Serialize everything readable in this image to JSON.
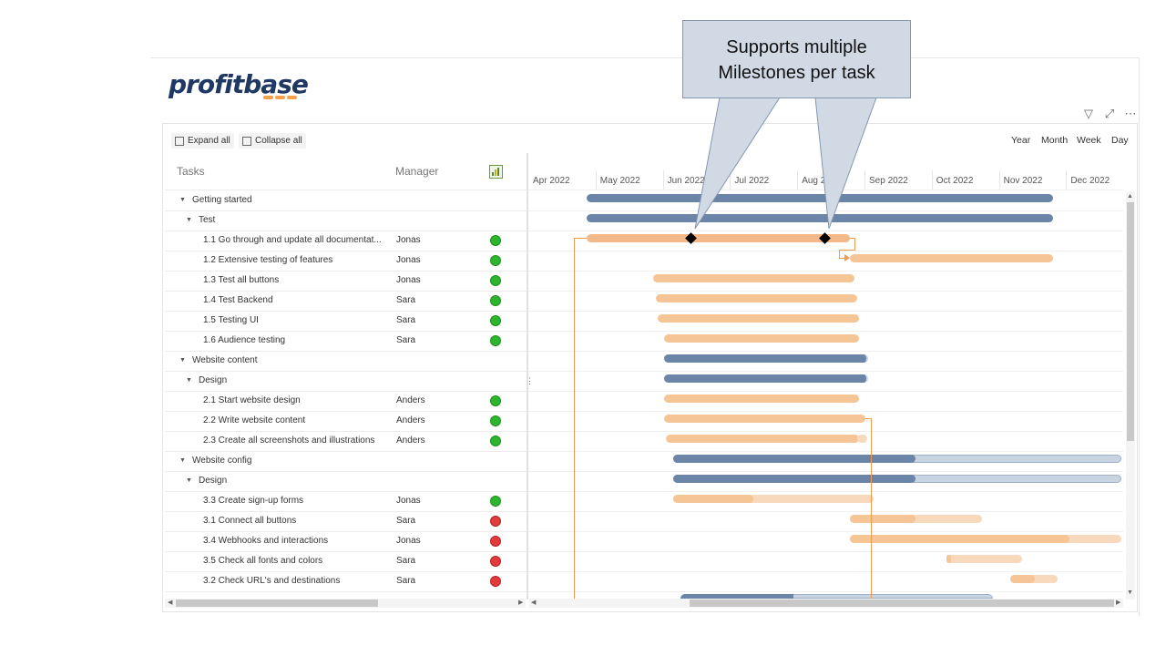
{
  "callout": {
    "line1": "Supports multiple",
    "line2": "Milestones per task"
  },
  "logo": {
    "text": "profitbase"
  },
  "toolbar": {
    "expand_label": "Expand all",
    "collapse_label": "Collapse all"
  },
  "views": [
    "Year",
    "Month",
    "Week",
    "Day"
  ],
  "headers": {
    "tasks": "Tasks",
    "manager": "Manager",
    "status_icon": "bar-chart-icon"
  },
  "months": [
    "Apr 2022",
    "May 2022",
    "Jun 2022",
    "Jul 2022",
    "Aug 2022",
    "Sep 2022",
    "Oct 2022",
    "Nov 2022",
    "Dec 2022"
  ],
  "rows": [
    {
      "level": 0,
      "name": "Getting started",
      "manager": "",
      "status": ""
    },
    {
      "level": 1,
      "name": "Test",
      "manager": "",
      "status": ""
    },
    {
      "level": 2,
      "name": "1.1 Go through and update all documentat...",
      "manager": "Jonas",
      "status": "green"
    },
    {
      "level": 2,
      "name": "1.2 Extensive testing of features",
      "manager": "Jonas",
      "status": "green"
    },
    {
      "level": 2,
      "name": "1.3 Test all buttons",
      "manager": "Jonas",
      "status": "green"
    },
    {
      "level": 2,
      "name": "1.4 Test Backend",
      "manager": "Sara",
      "status": "green"
    },
    {
      "level": 2,
      "name": "1.5 Testing UI",
      "manager": "Sara",
      "status": "green"
    },
    {
      "level": 2,
      "name": "1.6 Audience testing",
      "manager": "Sara",
      "status": "green"
    },
    {
      "level": 0,
      "name": "Website content",
      "manager": "",
      "status": ""
    },
    {
      "level": 1,
      "name": "Design",
      "manager": "",
      "status": ""
    },
    {
      "level": 2,
      "name": "2.1 Start website design",
      "manager": "Anders",
      "status": "green"
    },
    {
      "level": 2,
      "name": "2.2 Write website content",
      "manager": "Anders",
      "status": "green"
    },
    {
      "level": 2,
      "name": "2.3 Create all screenshots and illustrations",
      "manager": "Anders",
      "status": "green"
    },
    {
      "level": 0,
      "name": "Website config",
      "manager": "",
      "status": ""
    },
    {
      "level": 1,
      "name": "Design",
      "manager": "",
      "status": ""
    },
    {
      "level": 2,
      "name": "3.3 Create sign-up forms",
      "manager": "Jonas",
      "status": "green"
    },
    {
      "level": 2,
      "name": "3.1 Connect all buttons",
      "manager": "Sara",
      "status": "red"
    },
    {
      "level": 2,
      "name": "3.4 Webhooks and interactions",
      "manager": "Jonas",
      "status": "red"
    },
    {
      "level": 2,
      "name": "3.5 Check all fonts and colors",
      "manager": "Sara",
      "status": "red"
    },
    {
      "level": 2,
      "name": "3.2 Check URL's and destinations",
      "manager": "Sara",
      "status": "red"
    }
  ],
  "colors": {
    "summary": "#6a85a8",
    "task": "#f5c596",
    "dependency": "#f09a50",
    "green": "#2db52d",
    "red": "#e23b3b"
  },
  "icons": [
    "filter-icon",
    "focus-mode-icon",
    "more-options-icon"
  ]
}
